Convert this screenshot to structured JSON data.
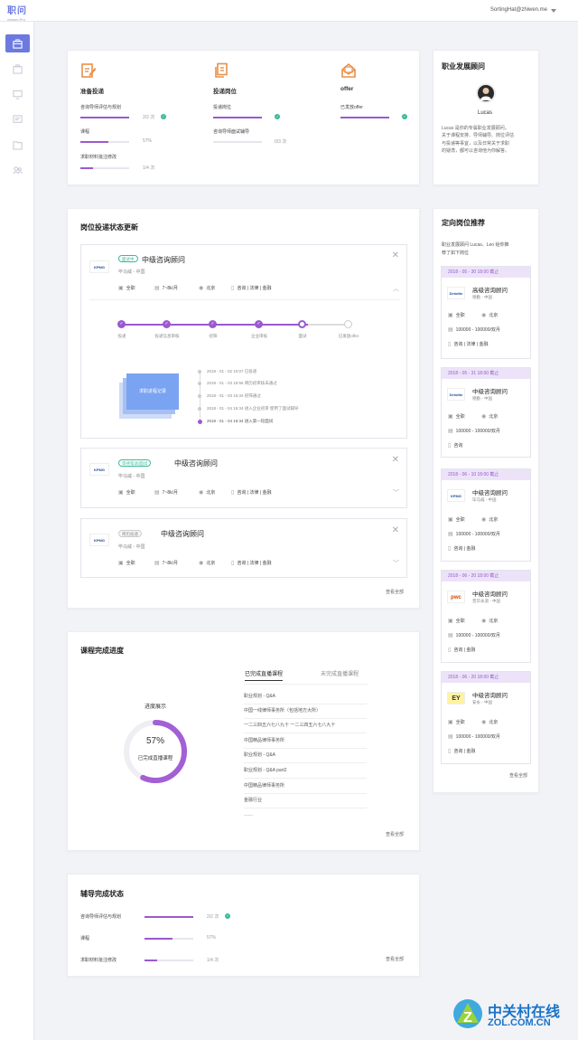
{
  "header": {
    "logo_main": "职问",
    "logo_sub": "zhiwen.Pro",
    "user": "SortingHat@zhiwen.me"
  },
  "sidebar": {
    "icons": [
      "briefcase-icon",
      "bag-icon",
      "monitor-icon",
      "document-icon",
      "folder-icon",
      "people-icon"
    ]
  },
  "stats": {
    "columns": [
      {
        "icon": "edit-doc-icon",
        "title": "准备投递",
        "rows": [
          {
            "label": "咨询导师评估与规划",
            "value": "2/2 次",
            "progress": 1.0,
            "done": true
          },
          {
            "label": "课程",
            "value": "57%",
            "progress": 0.57,
            "done": false
          },
          {
            "label": "求职材料批注修改",
            "value": "1/4 次",
            "progress": 0.25,
            "done": false
          }
        ]
      },
      {
        "icon": "copy-doc-icon",
        "title": "投递岗位",
        "rows": [
          {
            "label": "投递岗位",
            "value": "",
            "progress": 1.0,
            "done": true
          },
          {
            "label": "咨询导师面试辅导",
            "value": "0/3 次",
            "progress": 0.0,
            "done": false
          }
        ]
      },
      {
        "icon": "envelope-icon",
        "title": "offer",
        "rows": [
          {
            "label": "已发放offer",
            "value": "",
            "progress": 1.0,
            "done": true
          }
        ]
      }
    ]
  },
  "advisor": {
    "title": "职业发展顾问",
    "name": "Lucas",
    "desc": [
      "Lucas 是你的专属职业发展顾问，",
      "关于课程安排、导师辅导、岗位评估",
      "与投递等事宜，以及日常关于求职",
      "的疑虑，都可以咨询他为你解答。"
    ]
  },
  "applications": {
    "title": "岗位投递状态更新",
    "more": "查看全部",
    "jobs": [
      {
        "badge": "面试中",
        "badge_style": "green",
        "title": "中级咨询顾问",
        "company": "毕马威 - 中国",
        "logo": "KPMG",
        "type": "全职",
        "salary": "7~8k/月",
        "city": "北京",
        "tags": "咨询 | 法律 | 金融",
        "expanded": true
      },
      {
        "badge": "等待笔试/面试",
        "badge_style": "green",
        "title": "中级咨询顾问",
        "company": "毕马威 - 中国",
        "logo": "KPMG",
        "type": "全职",
        "salary": "7~8k/月",
        "city": "北京",
        "tags": "咨询 | 法律 | 金融",
        "expanded": false
      },
      {
        "badge": "简历投递",
        "badge_style": "grey",
        "title": "中级咨询顾问",
        "company": "毕马威 - 中国",
        "logo": "KPMG",
        "type": "全职",
        "salary": "7~8k/月",
        "city": "北京",
        "tags": "咨询 | 法律 | 金融",
        "expanded": false
      }
    ],
    "steps": [
      {
        "label": "投递",
        "state": "done"
      },
      {
        "label": "投递信息审核",
        "state": "done"
      },
      {
        "label": "初筛",
        "state": "done"
      },
      {
        "label": "企业审核",
        "state": "done"
      },
      {
        "label": "面试",
        "state": "current"
      },
      {
        "label": "已发放offer",
        "state": "todo"
      }
    ],
    "illus_label": "求职进程记录",
    "timeline": [
      "2018 - 01 - 02 10:07  已投递",
      "2018 - 01 - 03 19:56  简历初审核未通过",
      "2018 - 01 - 03 16:34  初筛通过",
      "2018 - 01 - 04 16:34  进入企业初审 使用了面试辅导",
      "2018 - 01 - 04 16:34  进入第一轮面试"
    ]
  },
  "courses": {
    "title": "课程完成进度",
    "donut_title": "进度展示",
    "percent": 57,
    "percent_label": "57%",
    "donut_caption": "已完成直播课程",
    "tab_active": "已完成直播课程",
    "tab_inactive": "未完成直播课程",
    "items": [
      "职业规划 - Q&A",
      "中国一线律师事务所（包括地方大所）",
      "一二三四五六七八九十 一二三四五六七八九十",
      "中国精品律师事务所",
      "职业规划 - Q&A",
      "职业规划 - Q&A part2",
      "中国精品律师事务所",
      "金融行业",
      "……"
    ],
    "more": "查看全部"
  },
  "coaching": {
    "title": "辅导完成状态",
    "rows": [
      {
        "label": "咨询导师评估与规划",
        "value": "2/2 次",
        "progress": 1.0,
        "done": true
      },
      {
        "label": "课程",
        "value": "57%",
        "progress": 0.57,
        "done": false
      },
      {
        "label": "求职材料批注修改",
        "value": "1/4 次",
        "progress": 0.25,
        "done": false
      }
    ],
    "more": "查看全部"
  },
  "recommend": {
    "title": "定向岗位推荐",
    "intro": [
      "职业发展顾问 Lucas、Leo 给你推",
      "荐了如下岗位"
    ],
    "more": "查看全部",
    "items": [
      {
        "date": "2018 - 05 - 30 18:00  截止",
        "title": "高级咨询顾问",
        "company": "德勤 - 中国",
        "logo": "Deloitte",
        "type": "全职",
        "city": "北京",
        "salary": "100000 - 100000/双月",
        "tags": "咨询 | 法律 | 金融"
      },
      {
        "date": "2018 - 05 - 31 18:00  截止",
        "title": "中级咨询顾问",
        "company": "德勤 - 中国",
        "logo": "Deloitte",
        "type": "全职",
        "city": "北京",
        "salary": "100000 - 100000/双月",
        "tags": "咨询"
      },
      {
        "date": "2018 - 06 - 10 18:00  截止",
        "title": "中级咨询顾问",
        "company": "毕马威 - 中国",
        "logo": "KPMG",
        "type": "全职",
        "city": "北京",
        "salary": "100000 - 100000/双月",
        "tags": "咨询 | 金融"
      },
      {
        "date": "2018 - 06 - 20 18:00  截止",
        "title": "中级咨询顾问",
        "company": "普华永道 - 中国",
        "logo": "pwc",
        "type": "全职",
        "city": "北京",
        "salary": "100000 - 100000/双月",
        "tags": "咨询 | 金融"
      },
      {
        "date": "2018 - 06 - 20 18:00  截止",
        "title": "中级咨询顾问",
        "company": "安永 - 中国",
        "logo": "EY",
        "type": "全职",
        "city": "北京",
        "salary": "100000 - 100000/双月",
        "tags": "咨询 | 金融"
      }
    ]
  },
  "watermark": {
    "text": "中关村在线",
    "url": "ZOL.COM.CN"
  }
}
